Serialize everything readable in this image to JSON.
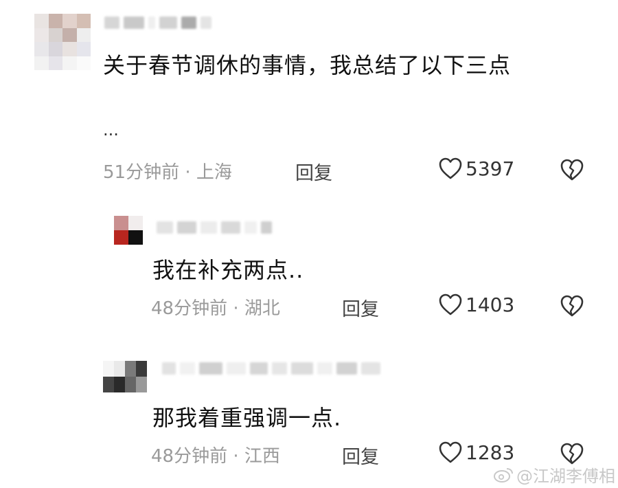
{
  "comments": [
    {
      "text": "关于春节调休的事情，我总结了以下三点",
      "ellipsis": "...",
      "meta": "51分钟前 · 上海",
      "reply_label": "回复",
      "likes": "5397"
    },
    {
      "text": "我在补充两点..",
      "meta": "48分钟前 · 湖北",
      "reply_label": "回复",
      "likes": "1403"
    },
    {
      "text": "那我着重强调一点.",
      "meta": "48分钟前 · 江西",
      "reply_label": "回复",
      "likes": "1283"
    }
  ],
  "watermark": {
    "text": "@江湖李傅相",
    "icon": "weibo-logo-icon"
  },
  "icons": {
    "like": "heart-outline-icon",
    "dislike": "broken-heart-icon"
  }
}
